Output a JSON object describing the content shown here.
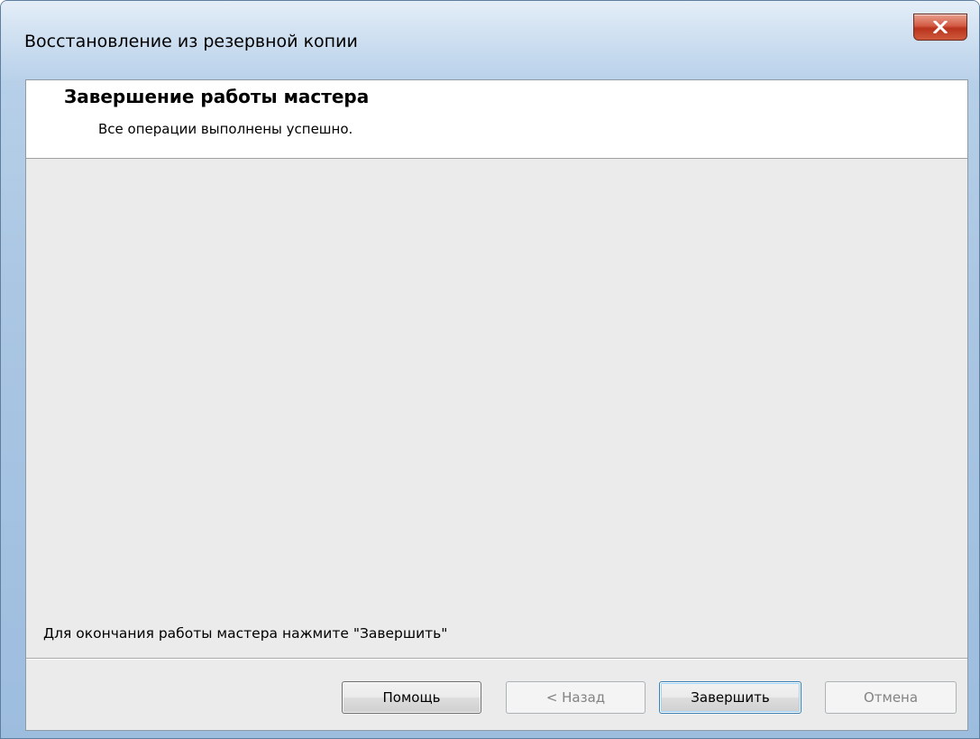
{
  "window": {
    "title": "Восстановление из резервной копии",
    "close_icon": "close-icon"
  },
  "header": {
    "title": "Завершение работы мастера",
    "subtitle": "Все операции выполнены успешно."
  },
  "body": {
    "hint": "Для окончания работы мастера нажмите \"Завершить\""
  },
  "buttons": {
    "help": {
      "label": "Помощь",
      "enabled": true
    },
    "back": {
      "label": "< Назад",
      "enabled": false
    },
    "finish": {
      "label": "Завершить",
      "enabled": true,
      "default": true
    },
    "cancel": {
      "label": "Отмена",
      "enabled": false
    }
  },
  "colors": {
    "close_button": "#c9452c",
    "client_background": "#ebebeb",
    "header_background": "#ffffff",
    "disabled_text": "#838383"
  }
}
